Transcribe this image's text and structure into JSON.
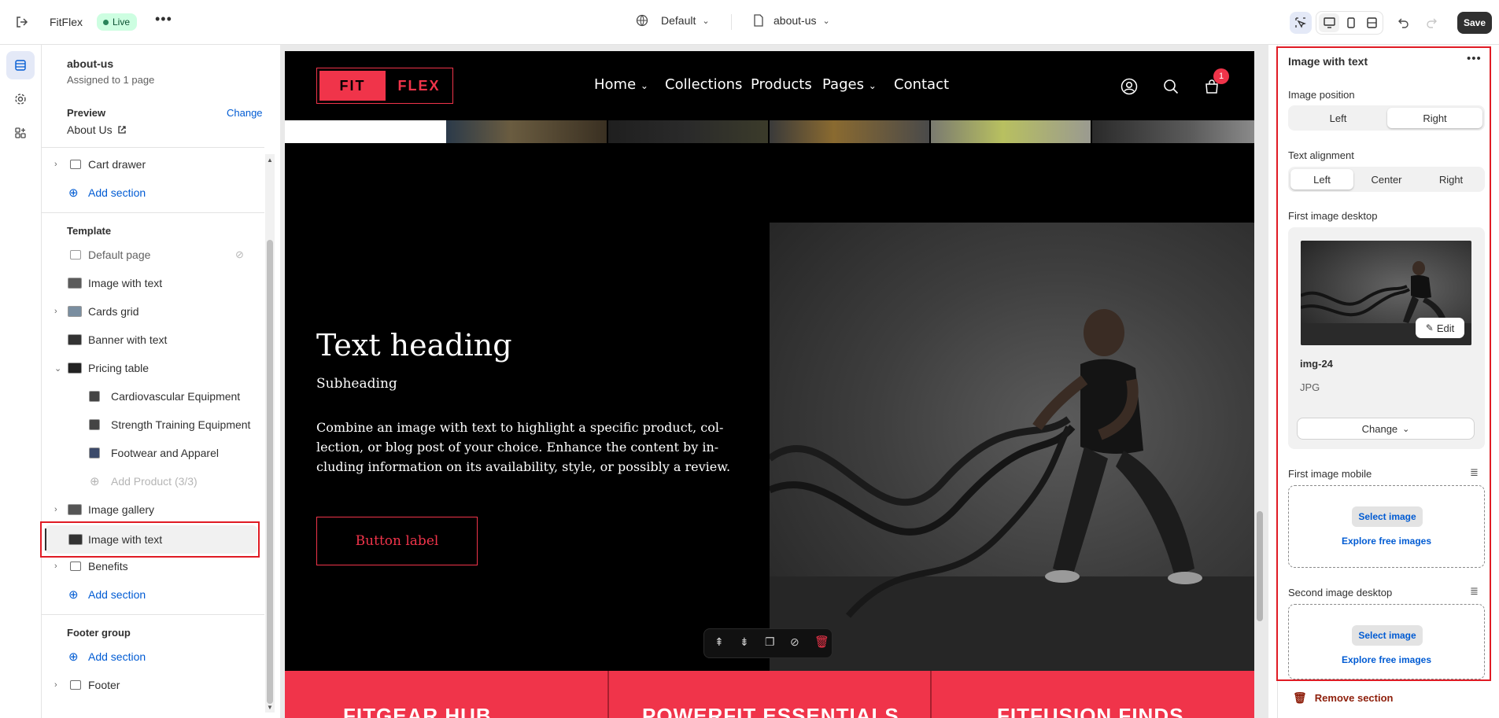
{
  "topbar": {
    "store_name": "FitFlex",
    "status_badge": "Live",
    "theme_selector": "Default",
    "page_selector": "about-us",
    "save_label": "Save"
  },
  "panel": {
    "page_title": "about-us",
    "assigned": "Assigned to 1 page",
    "preview_label": "Preview",
    "preview_change": "Change",
    "preview_page": "About Us",
    "items": {
      "cart_drawer": "Cart drawer",
      "add_section_1": "Add section",
      "template_heading": "Template",
      "default_page": "Default page",
      "image_with_text_1": "Image with text",
      "cards_grid": "Cards grid",
      "banner_with_text": "Banner with text",
      "pricing_table": "Pricing table",
      "cardio": "Cardiovascular Equipment",
      "strength": "Strength Training Equipment",
      "footwear": "Footwear and Apparel",
      "add_product": "Add Product (3/3)",
      "image_gallery": "Image gallery",
      "image_with_text_2": "Image with text",
      "benefits": "Benefits",
      "add_section_2": "Add section",
      "footer_group": "Footer group",
      "add_section_3": "Add section",
      "footer": "Footer"
    }
  },
  "site": {
    "logo_left": "FIT",
    "logo_right": "FLEX",
    "nav": [
      "Home",
      "Collections",
      "Products",
      "Pages",
      "Contact"
    ],
    "cart_count": "1",
    "heading": "Text heading",
    "subheading": "Subheading",
    "body_lines": [
      "Combine an image with text to highlight a specific product, col-",
      "lection, or blog post of your choice. Enhance the content by in-",
      "cluding information on its availability, style, or possibly a review."
    ],
    "button_label": "Button label",
    "footer_cards": [
      "FITGEAR HUB",
      "POWERFIT ESSENTIALS",
      "FITFUSION FINDS"
    ]
  },
  "settings": {
    "title": "Image with text",
    "image_position_label": "Image position",
    "image_position_options": [
      "Left",
      "Right"
    ],
    "image_position_selected": "Right",
    "text_alignment_label": "Text alignment",
    "text_alignment_options": [
      "Left",
      "Center",
      "Right"
    ],
    "text_alignment_selected": "Left",
    "first_image_desktop_label": "First image desktop",
    "edit_label": "Edit",
    "image_name": "img-24",
    "image_type": "JPG",
    "change_label": "Change",
    "first_image_mobile_label": "First image mobile",
    "select_image_label": "Select image",
    "explore_label": "Explore free images",
    "second_image_desktop_label": "Second image desktop",
    "remove_section_label": "Remove section"
  },
  "colors": {
    "accent_red": "#f0344a",
    "highlight_border": "#e01b24",
    "link_blue": "#005bd3",
    "live_green": "#2f8a4b"
  }
}
